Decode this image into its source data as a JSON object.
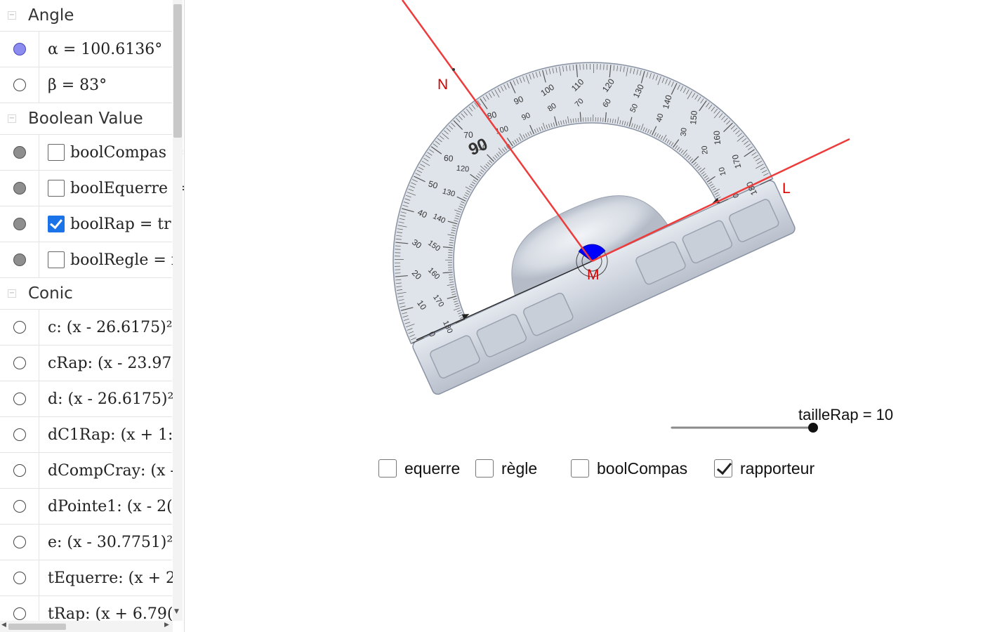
{
  "algebra": {
    "groups": {
      "angle": {
        "title": "Angle",
        "items": [
          {
            "text": "α = 100.6136°",
            "visible": "on"
          },
          {
            "text": "β = 83°",
            "visible": "off"
          }
        ]
      },
      "boolean": {
        "title": "Boolean Value",
        "items": [
          {
            "text": "boolCompas =",
            "checked": false
          },
          {
            "text": "boolEquerre =",
            "checked": false
          },
          {
            "text": "boolRap = tr",
            "checked": true
          },
          {
            "text": "boolRegle = f",
            "checked": false
          }
        ]
      },
      "conic": {
        "title": "Conic",
        "items": [
          {
            "text": "c: (x - 26.6175)²"
          },
          {
            "text": "cRap: (x - 23.97"
          },
          {
            "text": "d: (x - 26.6175)²"
          },
          {
            "text": "dC1Rap: (x + 1:"
          },
          {
            "text": "dCompCray: (x -"
          },
          {
            "text": "dPointe1: (x - 2("
          },
          {
            "text": "e: (x - 30.7751)²"
          },
          {
            "text": "tEquerre: (x + 2"
          },
          {
            "text": "tRap: (x + 6.79("
          }
        ]
      }
    }
  },
  "graphics": {
    "points": {
      "N": "N",
      "L": "L",
      "M": "M"
    },
    "protractor": {
      "outer_labels": [
        "0",
        "10",
        "20",
        "30",
        "40",
        "50",
        "60",
        "70",
        "80",
        "90",
        "100",
        "110",
        "120",
        "130",
        "140",
        "150",
        "160",
        "170",
        "180"
      ],
      "inner_labels": [
        "180",
        "170",
        "160",
        "150",
        "140",
        "130",
        "120",
        "110",
        "100",
        "90",
        "80",
        "70",
        "60",
        "50",
        "40",
        "30",
        "20",
        "10",
        "0"
      ],
      "big_label": "90"
    },
    "slider": {
      "label": "tailleRap = 10",
      "value": 10
    },
    "checkboxes": [
      {
        "label": "equerre",
        "checked": false
      },
      {
        "label": "règle",
        "checked": false
      },
      {
        "label": "boolCompas",
        "checked": false
      },
      {
        "label": "rapporteur",
        "checked": true
      }
    ],
    "colors": {
      "lines": "#ee3b3b",
      "angle_fill": "#0000ff",
      "labels": "#d50000"
    }
  }
}
